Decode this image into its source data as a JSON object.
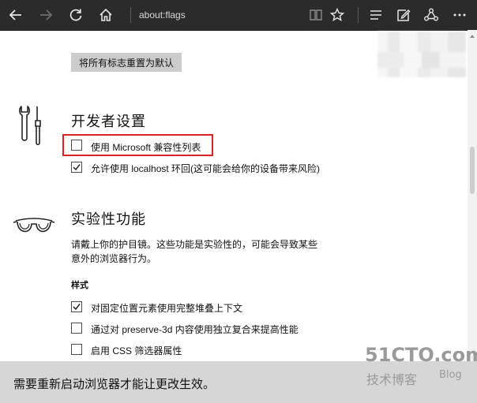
{
  "toolbar": {
    "address": "about:flags",
    "icons": [
      "back-icon",
      "forward-icon",
      "refresh-icon",
      "home-icon",
      "reading-view-icon",
      "favorite-star-icon",
      "hub-icon",
      "web-note-icon",
      "share-icon",
      "more-icon"
    ]
  },
  "reset_button": "将所有标志重置为默认",
  "developer": {
    "title": "开发者设置",
    "options": [
      {
        "label": "使用 Microsoft 兼容性列表",
        "checked": false
      },
      {
        "label": "允许使用 localhost 环回(这可能会给你的设备带来风险)",
        "checked": true
      }
    ]
  },
  "experimental": {
    "title": "实验性功能",
    "description": "请戴上你的护目镜。这些功能是实验性的，可能会导致某些意外的浏览器行为。",
    "subheading": "样式",
    "options": [
      {
        "label": "对固定位置元素使用完整堆叠上下文",
        "checked": true
      },
      {
        "label": "通过对 preserve-3d 内容使用独立复合来提高性能",
        "checked": false
      },
      {
        "label": "启用 CSS 筛选器属性",
        "checked": false
      }
    ]
  },
  "bottom_bar": "需要重新启动浏览器才能让更改生效。",
  "watermark": {
    "main": "51CTO.com",
    "sub": "技术博客",
    "blog": "Blog"
  },
  "colors": {
    "toolbar_bg": "#2b2b2b",
    "highlight": "#e02020",
    "bottom_bar_bg": "#d6d6d6"
  }
}
